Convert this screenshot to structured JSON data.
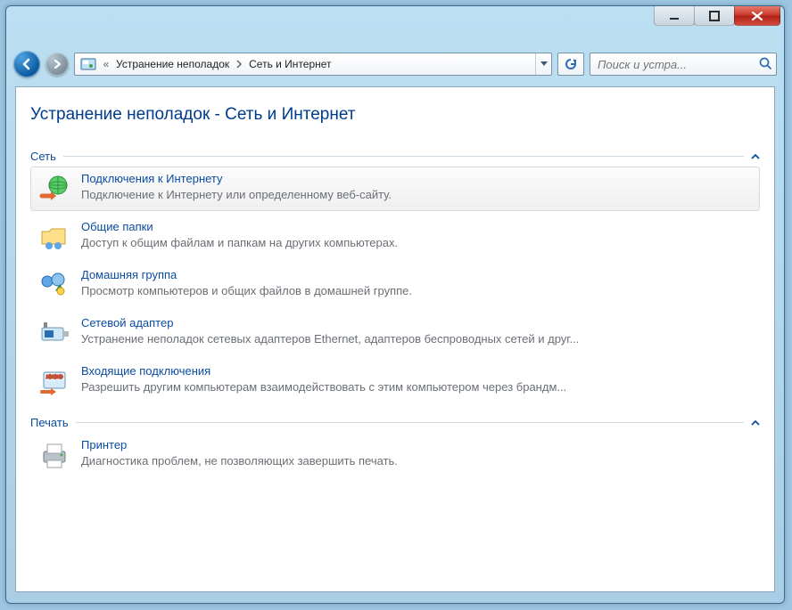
{
  "breadcrumb": {
    "seg1": "Устранение неполадок",
    "seg2": "Сеть и Интернет"
  },
  "search": {
    "placeholder": "Поиск и устра..."
  },
  "page": {
    "title": "Устранение неполадок - Сеть и Интернет"
  },
  "sections": [
    {
      "label": "Сеть",
      "items": [
        {
          "title": "Подключения к Интернету",
          "desc": "Подключение к Интернету или определенному веб-сайту.",
          "icon": "internet",
          "selected": true
        },
        {
          "title": "Общие папки",
          "desc": "Доступ к общим файлам и папкам на других компьютерах.",
          "icon": "folder"
        },
        {
          "title": "Домашняя группа",
          "desc": "Просмотр компьютеров и общих файлов в домашней группе.",
          "icon": "homegroup"
        },
        {
          "title": "Сетевой адаптер",
          "desc": "Устранение неполадок сетевых адаптеров Ethernet, адаптеров беспроводных сетей и друг...",
          "icon": "adapter"
        },
        {
          "title": "Входящие подключения",
          "desc": "Разрешить другим компьютерам взаимодействовать с этим компьютером через брандм...",
          "icon": "incoming"
        }
      ]
    },
    {
      "label": "Печать",
      "items": [
        {
          "title": "Принтер",
          "desc": "Диагностика проблем, не позволяющих завершить печать.",
          "icon": "printer"
        }
      ]
    }
  ]
}
